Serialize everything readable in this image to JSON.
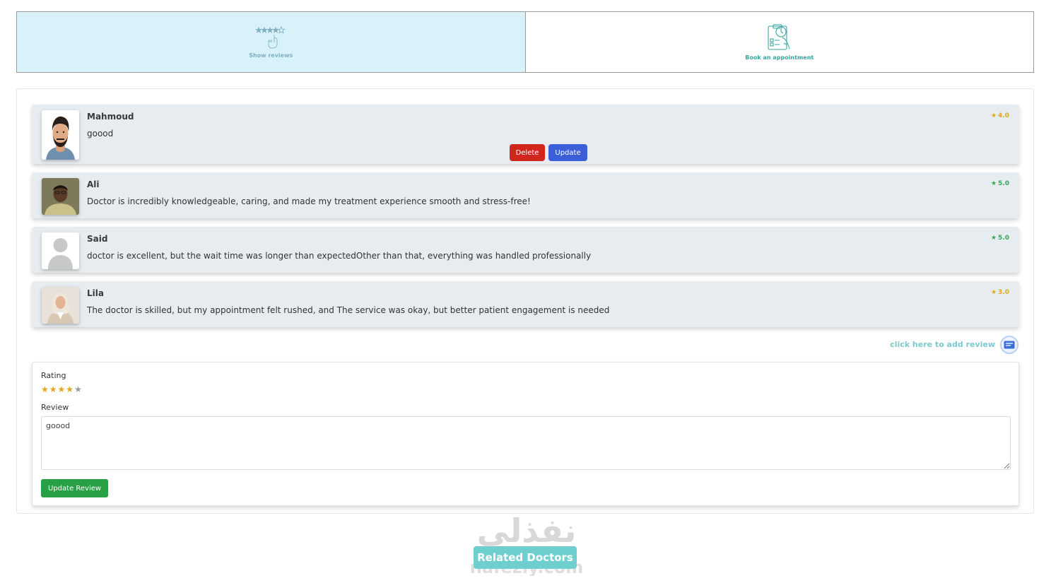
{
  "tabs": [
    {
      "label": "Show reviews",
      "active": true,
      "icon": "rating-hand-icon"
    },
    {
      "label": "Book an appointment",
      "active": false,
      "icon": "clipboard-clock-icon"
    }
  ],
  "reviews": [
    {
      "name": "Mahmoud",
      "text": "goood",
      "rating": "4.0",
      "rating_color": "#e2a81c",
      "avatar": "bearded-man-avatar",
      "actions": {
        "delete": "Delete",
        "update": "Update"
      }
    },
    {
      "name": "Ali",
      "text": "Doctor is incredibly knowledgeable, caring, and made my treatment experience smooth and stress-free!",
      "rating": "5.0",
      "rating_color": "#34a853",
      "avatar": "man-photo-avatar"
    },
    {
      "name": "Said",
      "text": "doctor is excellent, but the wait time was longer than expectedOther than that, everything was handled professionally",
      "rating": "5.0",
      "rating_color": "#34a853",
      "avatar": "default-user-avatar"
    },
    {
      "name": "Lila",
      "text": "The doctor is skilled, but my appointment felt rushed, and The service was okay, but better patient engagement is needed",
      "rating": "3.0",
      "rating_color": "#e2a81c",
      "avatar": "woman-photo-avatar"
    }
  ],
  "add_review": {
    "link_text": "click here to add review",
    "icon": "add-review-icon"
  },
  "form": {
    "rating_label": "Rating",
    "rating_value": 4,
    "rating_max": 5,
    "review_label": "Review",
    "review_value": "goood",
    "submit_label": "Update Review"
  },
  "related": {
    "label": "Related Doctors"
  },
  "watermark": {
    "arabic": "نفذلي",
    "latin": "nafezly.com"
  },
  "colors": {
    "active_tab": "#d9f1f8",
    "card_bg": "#e6ecf0",
    "delete": "#d0261e",
    "update": "#3a5fd8",
    "submit": "#28a045",
    "related": "#6fcfcf",
    "star_gold": "#e2a81c",
    "star_green": "#34a853"
  }
}
